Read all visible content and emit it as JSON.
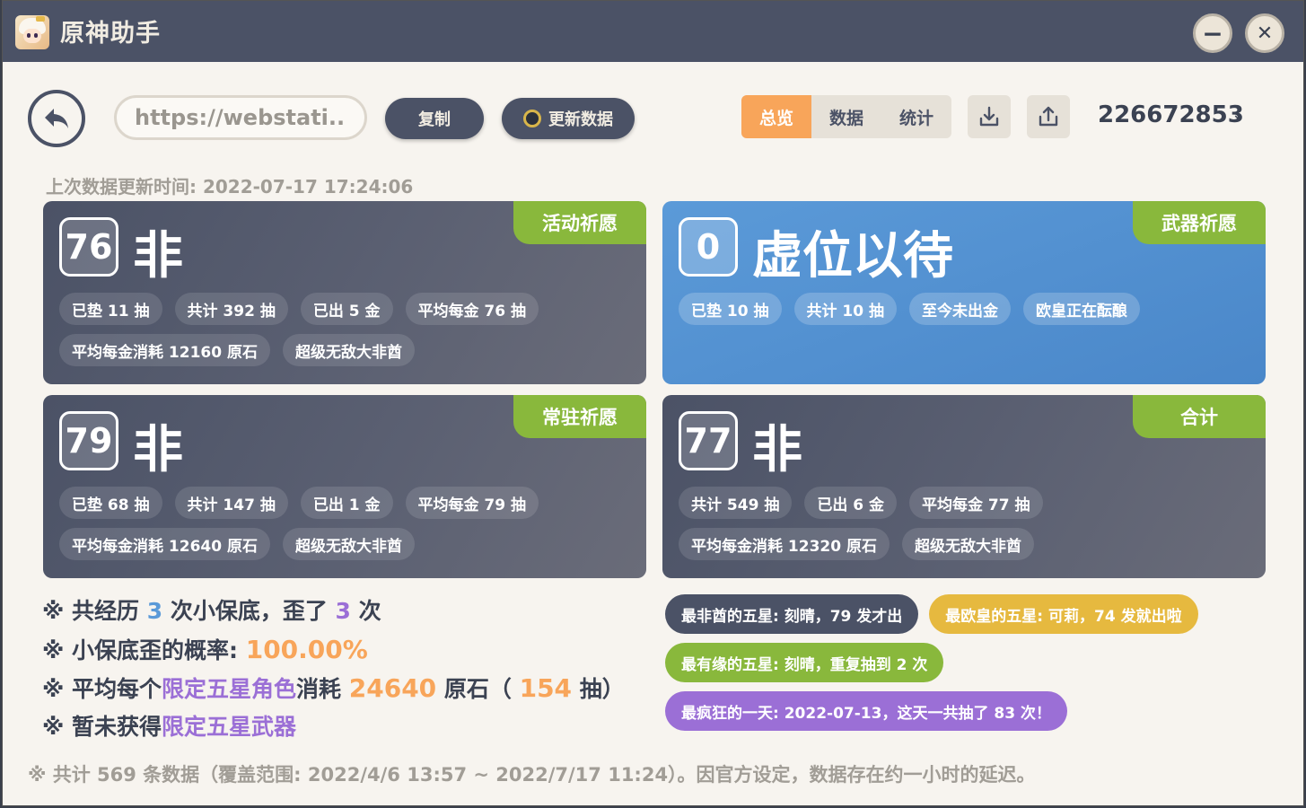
{
  "app": {
    "title": "原神助手"
  },
  "toolbar": {
    "url_value": "https://webstati...",
    "copy_label": "复制",
    "update_label": "更新数据",
    "tabs": [
      "总览",
      "数据",
      "统计"
    ],
    "active_tab": "总览",
    "uid": "226672853"
  },
  "last_update": "上次数据更新时间: 2022-07-17 17:24:06",
  "cards": [
    {
      "tag": "活动祈愿",
      "score": "76",
      "verdict": "非",
      "pills": [
        "已垫 11 抽",
        "共计 392 抽",
        "已出 5 金",
        "平均每金 76 抽",
        "平均每金消耗 12160 原石",
        "超级无敌大非酋"
      ]
    },
    {
      "tag": "武器祈愿",
      "score": "0",
      "verdict": "虚位以待",
      "pills": [
        "已垫 10 抽",
        "共计 10 抽",
        "至今未出金",
        "欧皇正在酝酿"
      ]
    },
    {
      "tag": "常驻祈愿",
      "score": "79",
      "verdict": "非",
      "pills": [
        "已垫 68 抽",
        "共计 147 抽",
        "已出 1 金",
        "平均每金 79 抽",
        "平均每金消耗 12640 原石",
        "超级无敌大非酋"
      ]
    },
    {
      "tag": "合计",
      "score": "77",
      "verdict": "非",
      "pills": [
        "共计 549 抽",
        "已出 6 金",
        "平均每金 77 抽",
        "平均每金消耗 12320 原石",
        "超级无敌大非酋"
      ]
    }
  ],
  "summary": {
    "l1_a": "※ 共经历 ",
    "l1_n1": "3",
    "l1_b": " 次小保底，歪了 ",
    "l1_n2": "3",
    "l1_c": " 次",
    "l2_a": "※ 小保底歪的概率: ",
    "l2_v": "100.00%",
    "l3_a": "※ 平均每个",
    "l3_link": "限定五星角色",
    "l3_b": "消耗 ",
    "l3_v1": "24640",
    "l3_c": " 原石（ ",
    "l3_v2": "154",
    "l3_d": " 抽）",
    "l4_a": "※ 暂未获得",
    "l4_link": "限定五星武器"
  },
  "badges": {
    "worst": "最非酋的五星: 刻晴，79 发才出",
    "best": "最欧皇的五星: 可莉，74 发就出啦",
    "fated": "最有缘的五星: 刻晴，重复抽到 2 次",
    "craziest": "最疯狂的一天: 2022-07-13，这天一共抽了 83 次！"
  },
  "footnote": "※ 共计 569 条数据（覆盖范围: 2022/4/6 13:57 ~ 2022/7/17 11:24）。因官方设定，数据存在约一小时的延迟。",
  "colors": {
    "titlebar": "#4b5266",
    "accent_orange": "#f8a55a",
    "tag_green": "#89b83c",
    "weapon_blue": "#4a87c9",
    "purple": "#9b6fd6",
    "gold": "#e6b93f"
  },
  "icons": {
    "back": "back-arrow-icon",
    "download": "download-icon",
    "share": "share-icon",
    "chevron": "chevron-down-icon"
  }
}
